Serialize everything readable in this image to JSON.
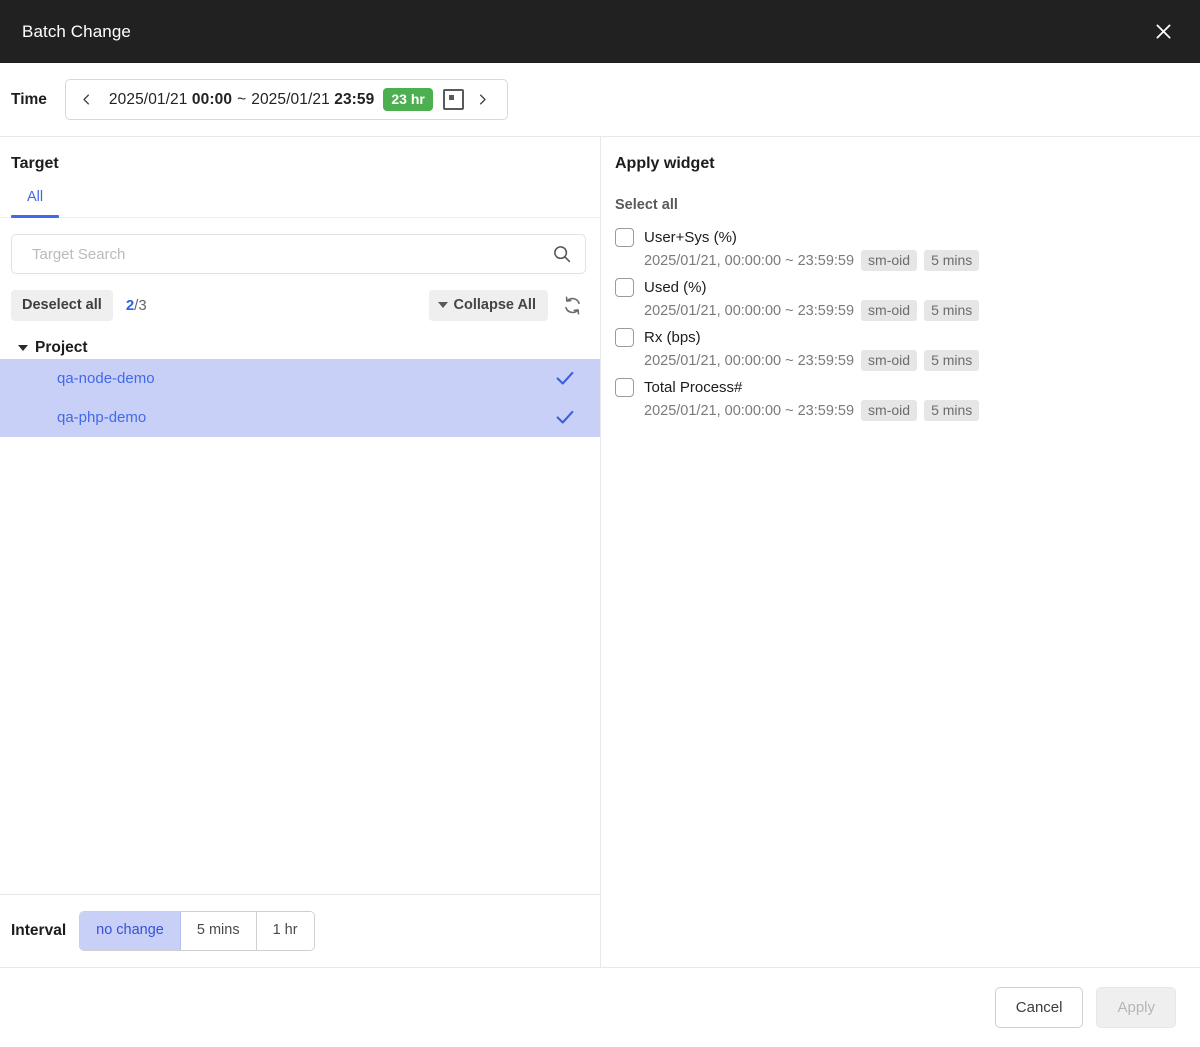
{
  "dialog": {
    "title": "Batch Change",
    "close_icon": "close-icon"
  },
  "time": {
    "label": "Time",
    "prev_icon": "chevron-left-icon",
    "next_icon": "chevron-right-icon",
    "start_date": "2025/01/21",
    "start_time": "00:00",
    "separator": "~",
    "end_date": "2025/01/21",
    "end_time": "23:59",
    "duration_badge": "23 hr",
    "duration_badge_color": "#4caf50",
    "range_icon": "date-range-icon"
  },
  "target": {
    "title": "Target",
    "tabs": [
      {
        "label": "All",
        "active": true
      }
    ],
    "search": {
      "placeholder": "Target Search",
      "value": "",
      "icon": "search-icon"
    },
    "toolbar": {
      "deselect_all": "Deselect all",
      "selected_count": "2",
      "count_separator": "/",
      "total_count": "3",
      "collapse_all": "Collapse All",
      "collapse_icon": "caret-down-icon",
      "refresh_icon": "refresh-icon"
    },
    "tree": {
      "group_label": "Project",
      "group_caret_icon": "caret-down-icon",
      "items": [
        {
          "label": "qa-node-demo",
          "selected": true,
          "check_icon": "check-icon"
        },
        {
          "label": "qa-php-demo",
          "selected": true,
          "check_icon": "check-icon"
        }
      ]
    }
  },
  "interval": {
    "label": "Interval",
    "options": [
      {
        "label": "no change",
        "active": true
      },
      {
        "label": "5 mins",
        "active": false
      },
      {
        "label": "1 hr",
        "active": false
      }
    ]
  },
  "apply_widget": {
    "title": "Apply widget",
    "select_all": "Select all",
    "items": [
      {
        "name": "User+Sys (%)",
        "checked": false,
        "date_range": "2025/01/21, 00:00:00 ~ 23:59:59",
        "tags": [
          "sm-oid",
          "5 mins"
        ]
      },
      {
        "name": "Used (%)",
        "checked": false,
        "date_range": "2025/01/21, 00:00:00 ~ 23:59:59",
        "tags": [
          "sm-oid",
          "5 mins"
        ]
      },
      {
        "name": "Rx (bps)",
        "checked": false,
        "date_range": "2025/01/21, 00:00:00 ~ 23:59:59",
        "tags": [
          "sm-oid",
          "5 mins"
        ]
      },
      {
        "name": "Total Process#",
        "checked": false,
        "date_range": "2025/01/21, 00:00:00 ~ 23:59:59",
        "tags": [
          "sm-oid",
          "5 mins"
        ]
      }
    ]
  },
  "footer": {
    "cancel": "Cancel",
    "apply": "Apply",
    "apply_disabled": true
  },
  "colors": {
    "accent_blue": "#4269e8",
    "selection_bg": "#c8d0f8",
    "badge_green": "#4caf50",
    "titlebar_bg": "#212121"
  }
}
